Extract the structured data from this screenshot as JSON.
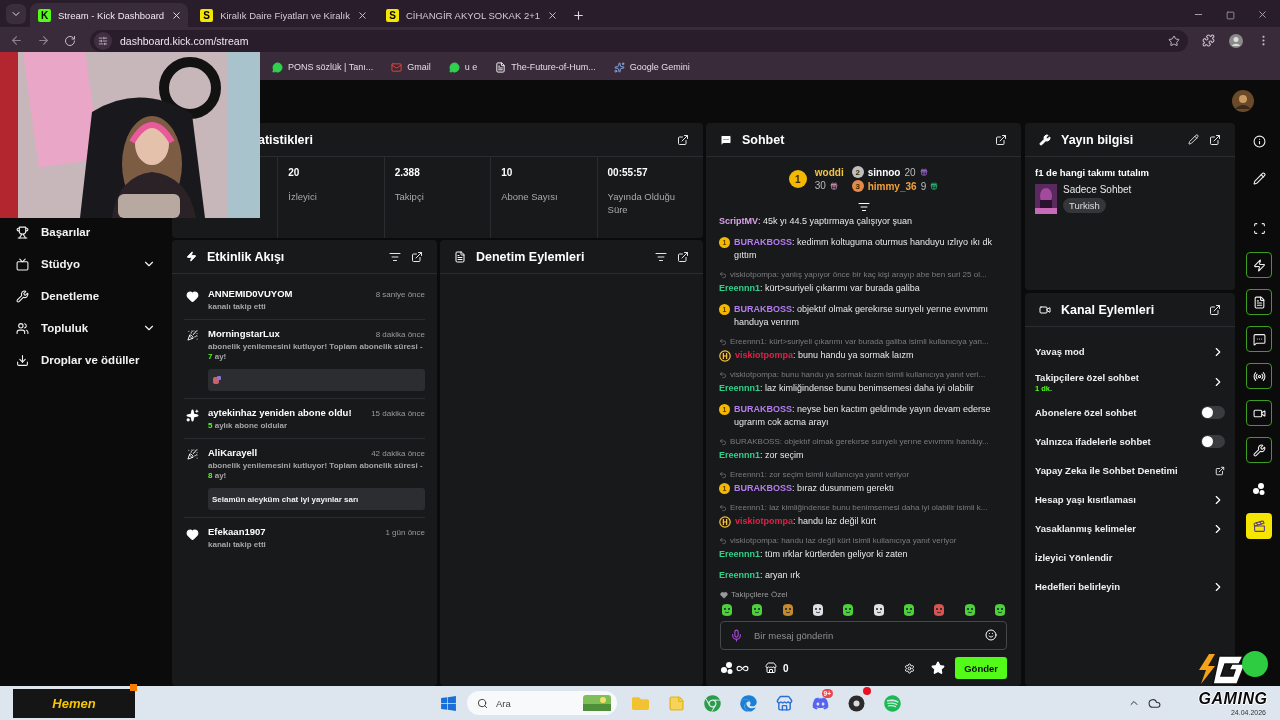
{
  "browser": {
    "tabs": [
      {
        "favicon": "K",
        "color": "#53fc18",
        "title": "Stream - Kick Dashboard",
        "selected": true
      },
      {
        "favicon": "S",
        "color": "#f4e600",
        "title": "Kiralık Daire Fiyatları ve Kiralık",
        "selected": false
      },
      {
        "favicon": "S",
        "color": "#f4e600",
        "title": "CİHANGİR AKYOL SOKAK 2+1",
        "selected": false
      }
    ],
    "address": "dashboard.kick.com/stream",
    "bookmarks": [
      {
        "label": "PONS sözlük | Tanı..."
      },
      {
        "label": "Gmail"
      },
      {
        "label": "u e"
      },
      {
        "label": "The-Future-of-Hum..."
      },
      {
        "label": "Google Gemini"
      }
    ]
  },
  "sidebar": {
    "items": [
      {
        "kind": "link",
        "label": "Başarılar"
      },
      {
        "kind": "group",
        "label": "Stüdyo",
        "expanded": false
      },
      {
        "kind": "link",
        "label": "Denetleme"
      },
      {
        "kind": "group",
        "label": "Topluluk",
        "expanded": false
      },
      {
        "kind": "link",
        "label": "Droplar ve ödüller"
      }
    ]
  },
  "stats": {
    "title": "atistikleri",
    "cells": [
      {
        "value": "20",
        "label": "İzleyici"
      },
      {
        "value": "2.388",
        "label": "Takipçi"
      },
      {
        "value": "10",
        "label": "Abone Sayısı"
      },
      {
        "value": "00:55:57",
        "label": "Yayında Olduğu Süre"
      }
    ]
  },
  "events": {
    "title": "Etkinlik Akışı",
    "items": [
      {
        "kind": "follow",
        "user": "ANNEMID0VUYOM",
        "time": "8 saniye önce",
        "text": "kanalı takip etti"
      },
      {
        "kind": "renew",
        "user": "MorningstarLux",
        "time": "8 dakika önce",
        "text": "abonelik yenilemesini kutluyor! Toplam abonelik süresi - ",
        "count": "7",
        "after": " ay!",
        "message": {
          "kind": "emote"
        }
      },
      {
        "kind": "resub",
        "user": "aytekinhaz yeniden abone oldu!",
        "time": "15 dakika önce",
        "count": "5",
        "after": " aylık abone oldular"
      },
      {
        "kind": "renew",
        "user": "AliKarayell",
        "time": "42 dakika önce",
        "text": "abonelik yenilemesini kutluyor! Toplam abonelik süresi - ",
        "count": "8",
        "after": " ay!",
        "message": {
          "kind": "text",
          "text": "Selamün aleyküm chat iyi yayınlar sarı"
        }
      },
      {
        "kind": "follow",
        "user": "Efekaan1907",
        "time": "1 gün önce",
        "text": "kanalı takip etti"
      }
    ]
  },
  "moderation": {
    "title": "Denetim Eylemleri"
  },
  "chat": {
    "title": "Sohbet",
    "leaders": [
      {
        "rank": "1",
        "user": "woddi",
        "count": "30",
        "color": "#f5c542"
      },
      {
        "rank": "2",
        "user": "sinnoo",
        "count": "20",
        "color": "#ffffff"
      },
      {
        "rank": "3",
        "user": "himmy_36",
        "count": "9",
        "color": "#f5a03a"
      }
    ],
    "messages": [
      {
        "user": "ScriptMV",
        "color": "#d9a3ea",
        "text": ": 45k yı 44.5 yaptırmaya çalışıyor şuan"
      },
      {
        "badge": {
          "kind": "sub",
          "label": "1"
        },
        "user": "BURAKBOSS",
        "color": "#b57cf0",
        "text": ": kedimm koltuguma oturmus handuyu ızlıyo ıkı dk gıttım"
      },
      {
        "reply": "viskiotpompa: yanlış yapıyor önce bir kaç kişi arayıp abe ben suri 25 ol...",
        "user": "Ereennn1",
        "color": "#2fd18a",
        "text": ": kürt>suriyeli çıkarımı var burada galiba"
      },
      {
        "badge": {
          "kind": "sub",
          "label": "1"
        },
        "user": "BURAKBOSS",
        "color": "#b57cf0",
        "text": ": objektıf olmak gerekırse surıyelı yerıne evıvmmı handuya verırım"
      },
      {
        "reply": "Ereennn1: kürt>suriyeli çıkarımı var burada galiba isimli kullanıcıya yan...",
        "badge": {
          "kind": "mod"
        },
        "user": "viskiotpompa",
        "color": "#e0204a",
        "text": ": bunu handu ya sormak laızm"
      },
      {
        "reply": "viskiotpompa: bunu handu ya sormak laızm isimli kullanıcıya yanıt veri...",
        "user": "Ereennn1",
        "color": "#2fd18a",
        "text": ": laz kimliğindense bunu benimsemesi daha iyi olabilir"
      },
      {
        "badge": {
          "kind": "sub",
          "label": "1"
        },
        "user": "BURAKBOSS",
        "color": "#b57cf0",
        "text": ": neyse ben kactım geldımde yayın devam ederse ugrarım cok acma arayı"
      },
      {
        "reply": "BURAKBOSS: objektıf olmak gerekırse surıyelı yerıne evıvmmı handuy...",
        "user": "Ereennn1",
        "color": "#2fd18a",
        "text": ": zor seçim"
      },
      {
        "reply": "Ereennn1: zor seçim isimli kullanıcıya yanıt veriyor",
        "badge": {
          "kind": "sub",
          "label": "1"
        },
        "user": "BURAKBOSS",
        "color": "#b57cf0",
        "text": ": bıraz dusunmem gerektı"
      },
      {
        "reply": "Ereennn1: laz kimliğindense bunu benimsemesi daha iyi olabilir isimli k...",
        "badge": {
          "kind": "mod"
        },
        "user": "viskiotpompa",
        "color": "#e0204a",
        "text": ": handu laz değil kürt"
      },
      {
        "reply": "viskiotpompa: handu laz değil kürt isimli kullanıcıya yanıt veriyor",
        "user": "Ereennn1",
        "color": "#2fd18a",
        "text": ": tüm ırklar kürtlerden geliyor ki zaten"
      },
      {
        "user": "Ereennn1",
        "color": "#2fd18a",
        "text": ": aryan ırk"
      }
    ],
    "emote_label": "Takipçilere Özel",
    "placeholder": "Bir mesaj gönderin",
    "points": "0",
    "send": "Gönder"
  },
  "stream_info": {
    "title": "Yayın bilgisi",
    "stream_title": "f1 de hangi takımı tutalım",
    "category": "Sadece Sohbet",
    "tags": [
      "Turkish"
    ]
  },
  "channel_actions": {
    "title": "Kanal Eylemleri",
    "items": [
      {
        "kind": "link",
        "label": "Yavaş mod"
      },
      {
        "kind": "link",
        "label": "Takipçilere özel sohbet",
        "detail": "1 dk."
      },
      {
        "kind": "toggle",
        "label": "Abonelere özel sohbet",
        "on": false
      },
      {
        "kind": "toggle",
        "label": "Yalnızca ifadelerle sohbet",
        "on": false
      },
      {
        "kind": "external",
        "label": "Yapay Zeka ile Sohbet Denetimi"
      },
      {
        "kind": "link",
        "label": "Hesap yaşı kısıtlaması"
      },
      {
        "kind": "link",
        "label": "Yasaklanmış kelimeler"
      },
      {
        "kind": "plain",
        "label": "İzleyici Yönlendir"
      },
      {
        "kind": "link",
        "label": "Hedefleri belirleyin"
      }
    ]
  },
  "rail": [
    {
      "on": false
    },
    {
      "on": false
    },
    {
      "on": false
    },
    {
      "on": true
    },
    {
      "on": true
    },
    {
      "on": true
    },
    {
      "on": true
    },
    {
      "on": true
    },
    {
      "on": true
    },
    {
      "on": false
    },
    {
      "on": false
    }
  ],
  "taskbar": {
    "widget": "Hemen",
    "search": "Ara",
    "apps": [
      {
        "notification": false
      },
      {
        "notification": false
      },
      {
        "notification": false
      },
      {
        "notification": false
      },
      {
        "notification": false
      },
      {
        "notification": false,
        "badge": "9+"
      },
      {
        "notification": true
      },
      {
        "notification": false
      }
    ],
    "date": "24.04.2026"
  },
  "overlay": {
    "logo": "GAMING"
  }
}
